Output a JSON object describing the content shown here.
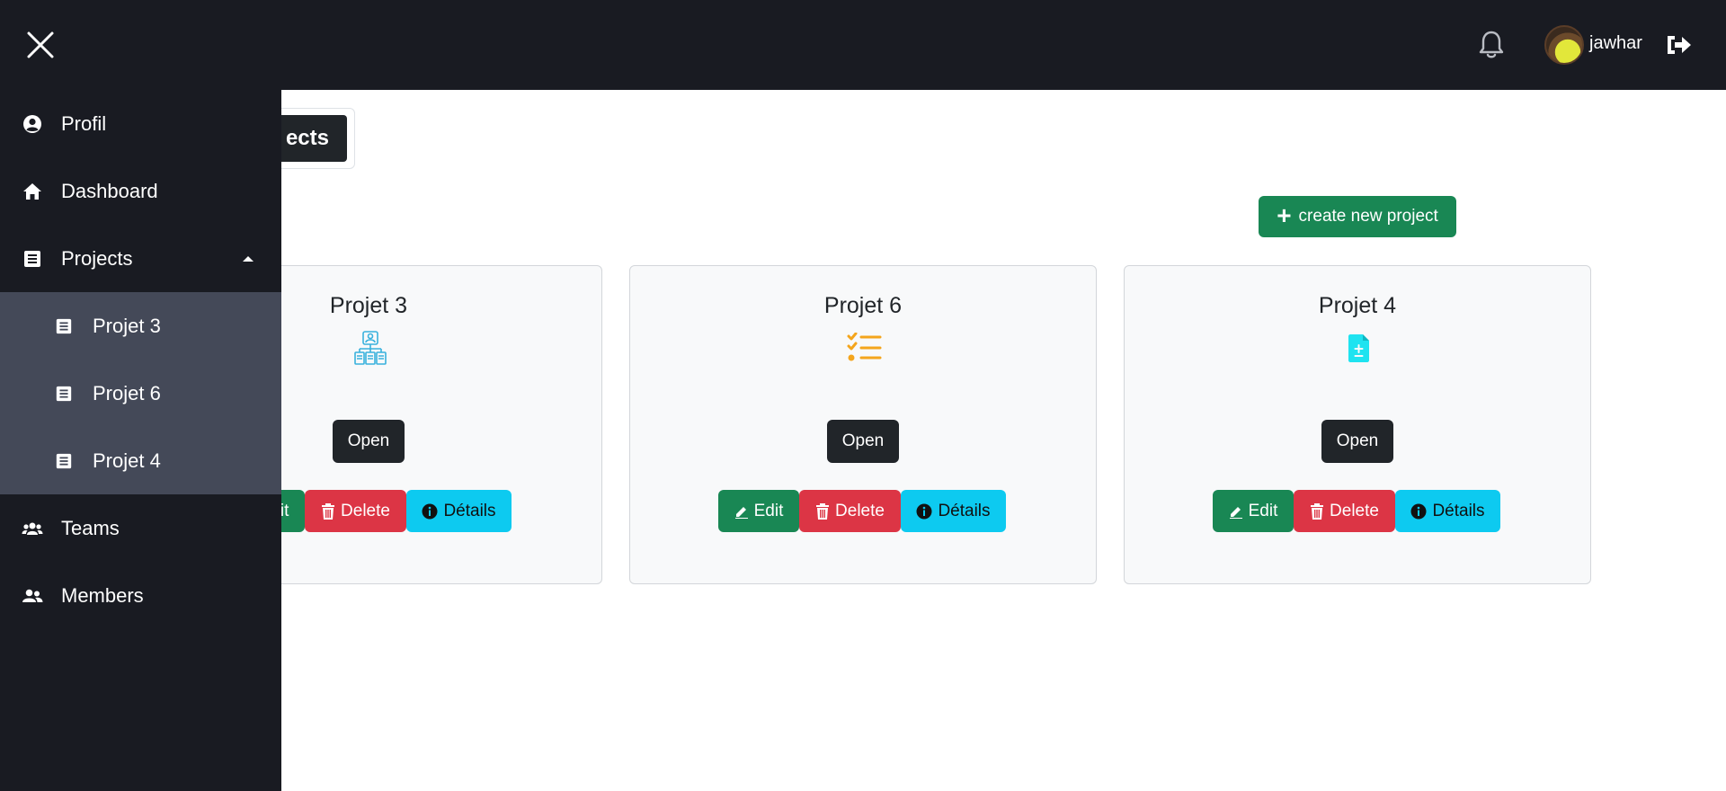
{
  "header": {
    "close_icon": "close-icon",
    "bell_icon": "bell-icon",
    "username": "jawhar",
    "logout_icon": "sign-out-icon",
    "background": "#191b22"
  },
  "sidebar": {
    "items": [
      {
        "label": "Profil",
        "icon": "user-circle-icon"
      },
      {
        "label": "Dashboard",
        "icon": "home-icon"
      },
      {
        "label": "Projects",
        "icon": "newspaper-icon",
        "expanded": true
      },
      {
        "label": "Teams",
        "icon": "users-icon"
      },
      {
        "label": "Members",
        "icon": "user-friends-icon"
      }
    ],
    "sub_items": [
      {
        "label": "Projet 3",
        "icon": "newspaper-icon"
      },
      {
        "label": "Projet 6",
        "icon": "newspaper-icon"
      },
      {
        "label": "Projet 4",
        "icon": "newspaper-icon"
      }
    ],
    "colors": {
      "background": "#191b22",
      "submenu": "#444958"
    }
  },
  "main": {
    "tab_label": "ects",
    "create_button": "create new project",
    "cards": [
      {
        "title": "Projet 3",
        "icon": "team-project-icon",
        "icon_color": "#39b1dd",
        "open": "Open",
        "edit": "Edit",
        "delete": "Delete",
        "details": "Détails"
      },
      {
        "title": "Projet 6",
        "icon": "checklist-icon",
        "icon_color": "#f4a51c",
        "open": "Open",
        "edit": "Edit",
        "delete": "Delete",
        "details": "Détails"
      },
      {
        "title": "Projet 4",
        "icon": "document-add-icon",
        "icon_color": "#1fe3f0",
        "open": "Open",
        "edit": "Edit",
        "delete": "Delete",
        "details": "Détails"
      }
    ],
    "colors": {
      "edit": "#198754",
      "delete": "#dc3545",
      "details": "#0dcaf0",
      "open": "#212529"
    }
  }
}
